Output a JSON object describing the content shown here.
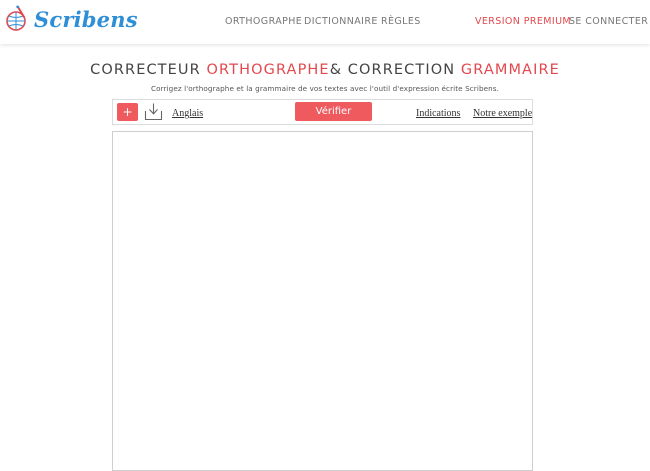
{
  "brand": {
    "name": "Scribens",
    "accent_color": "#e2494e",
    "logo_color": "#2e8fd6"
  },
  "nav": {
    "orthographe": "ORTHOGRAPHE",
    "dictionnaire": "DICTIONNAIRE",
    "regles": "RÈGLES",
    "premium": "VERSION PREMIUM",
    "connecter": "SE CONNECTER"
  },
  "heading": {
    "part1": "CORRECTEUR",
    "part2": "ORTHOGRAPHE",
    "part3": "& CORRECTION",
    "part4": "GRAMMAIRE"
  },
  "subtitle": "Corrigez l'orthographe et la grammaire de vos textes avec l'outil d'expression écrite Scribens.",
  "toolbar": {
    "add_label": "+",
    "download_icon": "download-icon",
    "language": "Anglais",
    "verify_label": "Vérifier",
    "indications": "Indications",
    "example": "Notre exemple"
  },
  "editor": {
    "text": ""
  }
}
